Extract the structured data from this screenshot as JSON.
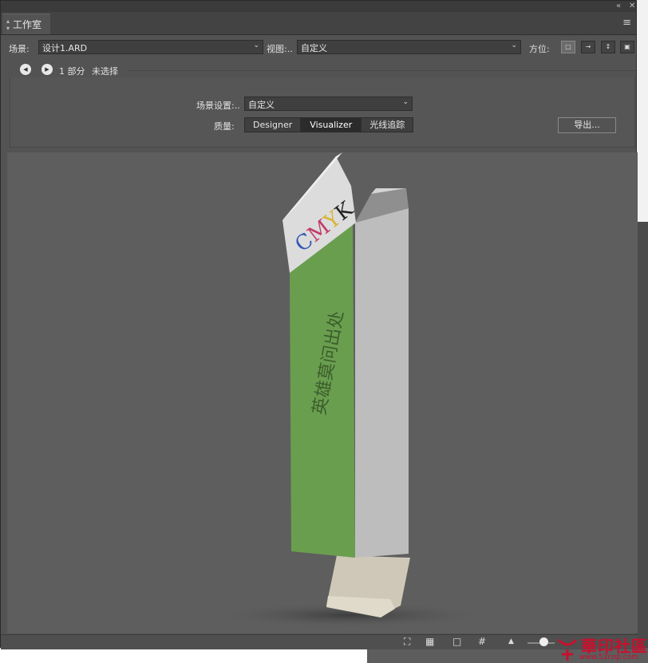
{
  "panel": {
    "tab_title": "工作室",
    "collapse_glyph": "«",
    "close_glyph": "✕",
    "menu_glyph": "≡"
  },
  "toolbar": {
    "scene_label": "场景:",
    "scene_value": "设计1.ARD",
    "view_label": "视图:..",
    "view_value": "自定义",
    "orientation_label": "方位:"
  },
  "nav": {
    "parts_text": "1 部分",
    "selection_text": "未选择"
  },
  "settings": {
    "scene_settings_label": "场景设置:..",
    "scene_settings_value": "自定义",
    "quality_label": "质量:",
    "quality_options": [
      "Designer",
      "Visualizer",
      "光线追踪"
    ],
    "quality_selected": "Visualizer",
    "export_label": "导出..."
  },
  "viewport": {
    "box_flap_text": "CMYK",
    "box_front_text": "英雄莫问出处",
    "box_front_color": "#6a9e4f",
    "box_side_color": "#b9b9b9"
  },
  "watermark": {
    "text": "華印社區",
    "url": "www.52cnp.com"
  }
}
